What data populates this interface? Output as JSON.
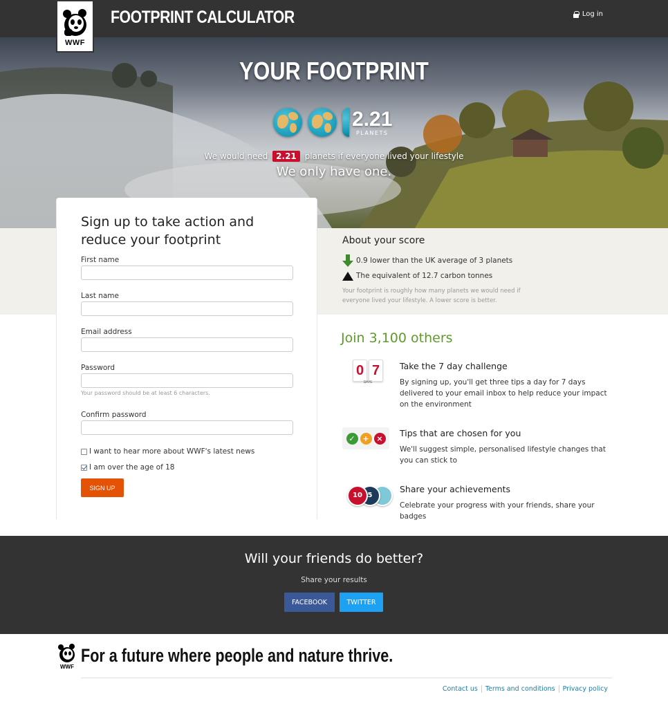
{
  "header": {
    "logo_text": "WWF",
    "app_title": "FOOTPRINT CALCULATOR",
    "login_label": "Log in"
  },
  "hero": {
    "title": "YOUR FOOTPRINT",
    "score": "2.21",
    "score_unit": "PLANETS",
    "need_prefix": "We would need",
    "need_value": "2.21",
    "need_suffix": "planets if everyone lived your lifestyle",
    "tagline": "We only have one."
  },
  "form": {
    "title": "Sign up to take action and reduce your footprint",
    "first_name_label": "First name",
    "first_name_value": "",
    "last_name_label": "Last name",
    "last_name_value": "",
    "email_label": "Email address",
    "email_value": "",
    "password_label": "Password",
    "password_value": "",
    "password_help": "Your password should be at least 6 characters.",
    "confirm_label": "Confirm password",
    "confirm_value": "",
    "news_label": "I want to hear more about WWF's latest news",
    "news_checked": false,
    "age_label": "I am over the age of 18",
    "age_checked": true,
    "signup_label": "SIGN UP"
  },
  "about": {
    "title": "About your score",
    "comparison": "0.9 lower than the UK average of 3 planets",
    "carbon": "The equivalent of 12.7 carbon tonnes",
    "note": "Your footprint is roughly how many planets we would need if everyone lived your lifestyle. A lower score is better."
  },
  "join": {
    "title": "Join 3,100 others",
    "features": [
      {
        "title": "Take the 7 day challenge",
        "text": "By signing up, you'll get three tips a day for 7 days delivered to your email inbox to help reduce your impact on the environment",
        "icon_digits": [
          "0",
          "7"
        ],
        "icon_label": "DAYS"
      },
      {
        "title": "Tips that are chosen for you",
        "text": "We'll suggest simple, personalised lifestyle changes that you can stick to"
      },
      {
        "title": "Share your achievements",
        "text": "Celebrate your progress with your friends, share your badges",
        "badges": [
          "10",
          "5"
        ]
      }
    ]
  },
  "share": {
    "title": "Will your friends do better?",
    "subtitle": "Share your results",
    "facebook_label": "FACEBOOK",
    "twitter_label": "TWITTER"
  },
  "footer": {
    "logo_text": "WWF",
    "slogan": "For a future where people and nature thrive.",
    "links": [
      "Contact us",
      "Terms and conditions",
      "Privacy policy"
    ]
  },
  "colors": {
    "header_bg": "#333333",
    "accent_orange": "#e35205",
    "accent_green": "#5e9b2a",
    "badge_red": "#c8102e",
    "facebook_blue": "#3b5998",
    "twitter_blue": "#1da1f2",
    "link_blue": "#1a7fa8"
  }
}
